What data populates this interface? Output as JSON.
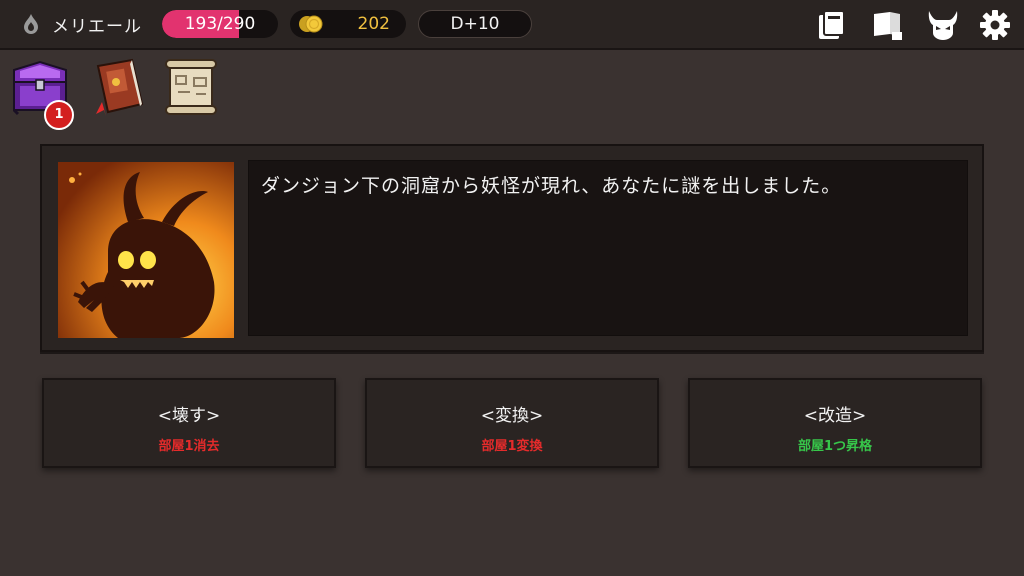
{
  "header": {
    "player_name": "メリエール",
    "hp": {
      "current": 193,
      "max": 290,
      "label": "193/290",
      "fraction": 0.6655
    },
    "gold": "202",
    "day": "D+10",
    "icons": [
      "card-icon",
      "book-icon",
      "demon-helmet-icon",
      "gear-icon"
    ]
  },
  "items": {
    "chest_badge": "1",
    "icons": [
      "treasure-chest-icon",
      "spellbook-icon",
      "scroll-icon"
    ]
  },
  "event": {
    "message": "ダンジョン下の洞窟から妖怪が現れ、あなたに謎を出しました。",
    "portrait": "demon-portrait"
  },
  "choices": [
    {
      "title": "<壊す>",
      "subtitle": "部屋1消去",
      "subtitle_color": "#e52b2b"
    },
    {
      "title": "<変換>",
      "subtitle": "部屋1変換",
      "subtitle_color": "#e52b2b"
    },
    {
      "title": "<改造>",
      "subtitle": "部屋1つ昇格",
      "subtitle_color": "#37c64a"
    }
  ],
  "colors": {
    "background": "#3a3230",
    "panel": "#2a2422",
    "hp_bar": "#e2336f",
    "gold_text": "#f0c040"
  }
}
